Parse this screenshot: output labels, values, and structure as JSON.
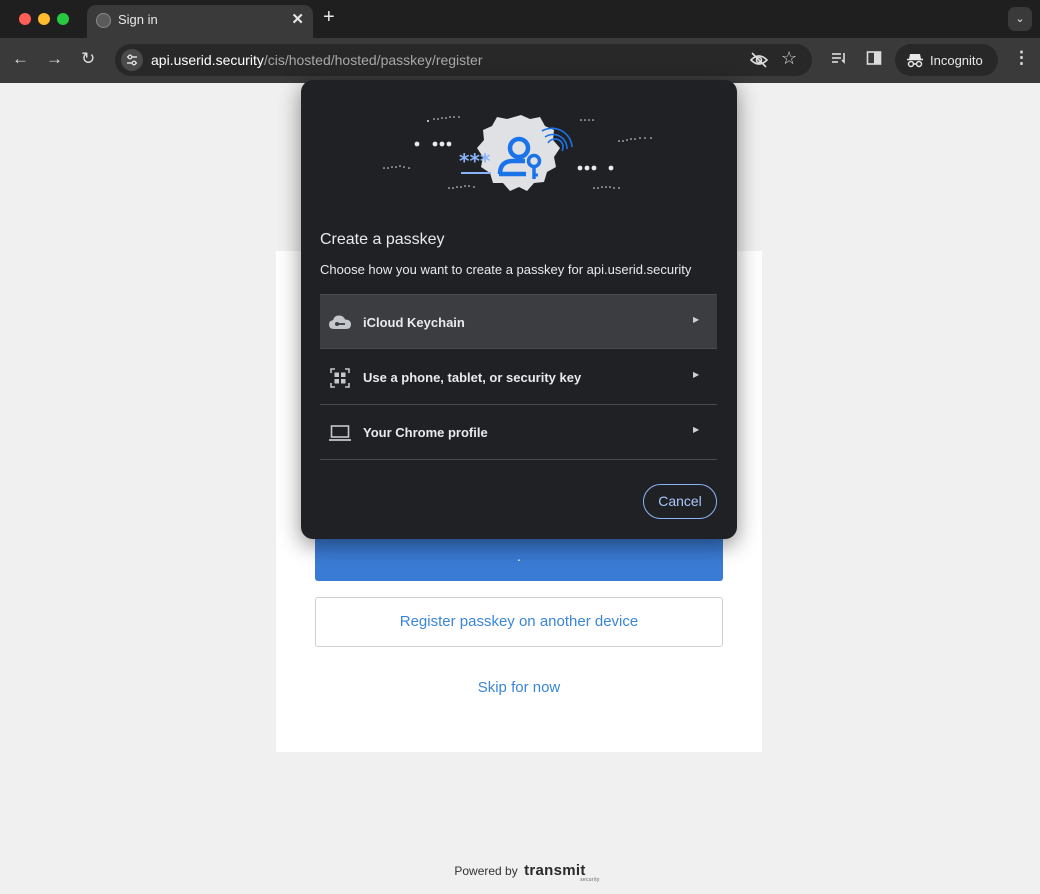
{
  "browser": {
    "tab_title": "Sign in",
    "tab_close": "✕",
    "new_tab": "+",
    "tab_search": "⌄",
    "url_host": "api.userid.security",
    "url_path": "/cis/hosted/hosted/passkey/register",
    "incognito_label": "Incognito",
    "icons": [
      "back-icon",
      "forward-icon",
      "reload-icon",
      "site-info-icon",
      "eye-off-icon",
      "star-icon",
      "reading-list-icon",
      "side-panel-icon",
      "incognito-icon",
      "kebab-menu-icon"
    ]
  },
  "page": {
    "primary_button_label": "·",
    "secondary_button_label": "Register passkey on another device",
    "skip_link": "Skip for now",
    "powered_by": "Powered by",
    "brand": "transmit",
    "brand_sub": "security"
  },
  "dialog": {
    "title": "Create a passkey",
    "description": "Choose how you want to create a passkey for api.userid.security",
    "options": [
      {
        "label": "iCloud Keychain",
        "icon": "cloud-key-icon"
      },
      {
        "label": "Use a phone, tablet, or security key",
        "icon": "qr-code-icon"
      },
      {
        "label": "Your Chrome profile",
        "icon": "laptop-icon"
      }
    ],
    "cancel_label": "Cancel",
    "accent_color": "#1a73e8"
  }
}
